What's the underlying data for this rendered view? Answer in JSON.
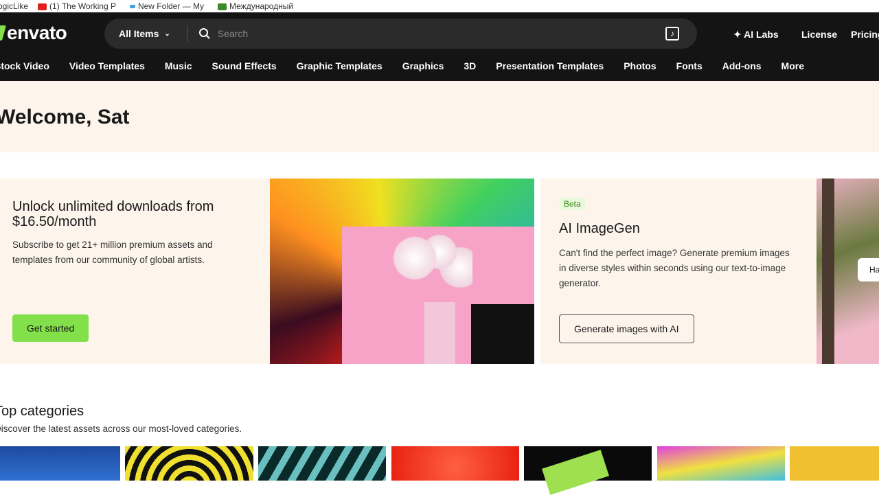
{
  "bookmarks": [
    {
      "label": "ogicLike",
      "color": "#ffffff"
    },
    {
      "label": "(1) The Working P",
      "color": "#e02020"
    },
    {
      "label": "New Folder — My",
      "color": "#3aa0e0"
    },
    {
      "label": "Международный",
      "color": "#3c8a2a"
    }
  ],
  "header": {
    "logo": "envato",
    "search": {
      "category": "All Items",
      "placeholder": "Search"
    },
    "links": [
      "AI Labs",
      "License",
      "Pricing"
    ]
  },
  "nav": [
    "Stock Video",
    "Video Templates",
    "Music",
    "Sound Effects",
    "Graphic Templates",
    "Graphics",
    "3D",
    "Presentation Templates",
    "Photos",
    "Fonts",
    "Add-ons",
    "More"
  ],
  "welcome": "Welcome, Sat",
  "promo": {
    "title": "Unlock unlimited downloads from $16.50/month",
    "text": "Subscribe to get 21+ million premium assets and templates from our community of global artists.",
    "button": "Get started"
  },
  "imagegen": {
    "badge": "Beta",
    "title": "AI ImageGen",
    "text": "Can't find the perfect image? Generate premium images in diverse styles within seconds using our text-to-image generator.",
    "button": "Generate images with AI",
    "peek_button": "Ha"
  },
  "categories": {
    "title": "Top categories",
    "subtitle": "Discover the latest assets across our most-loved categories."
  },
  "colors": {
    "header": "#141414",
    "accent": "#82e04a",
    "cream": "#fdf4ec"
  }
}
